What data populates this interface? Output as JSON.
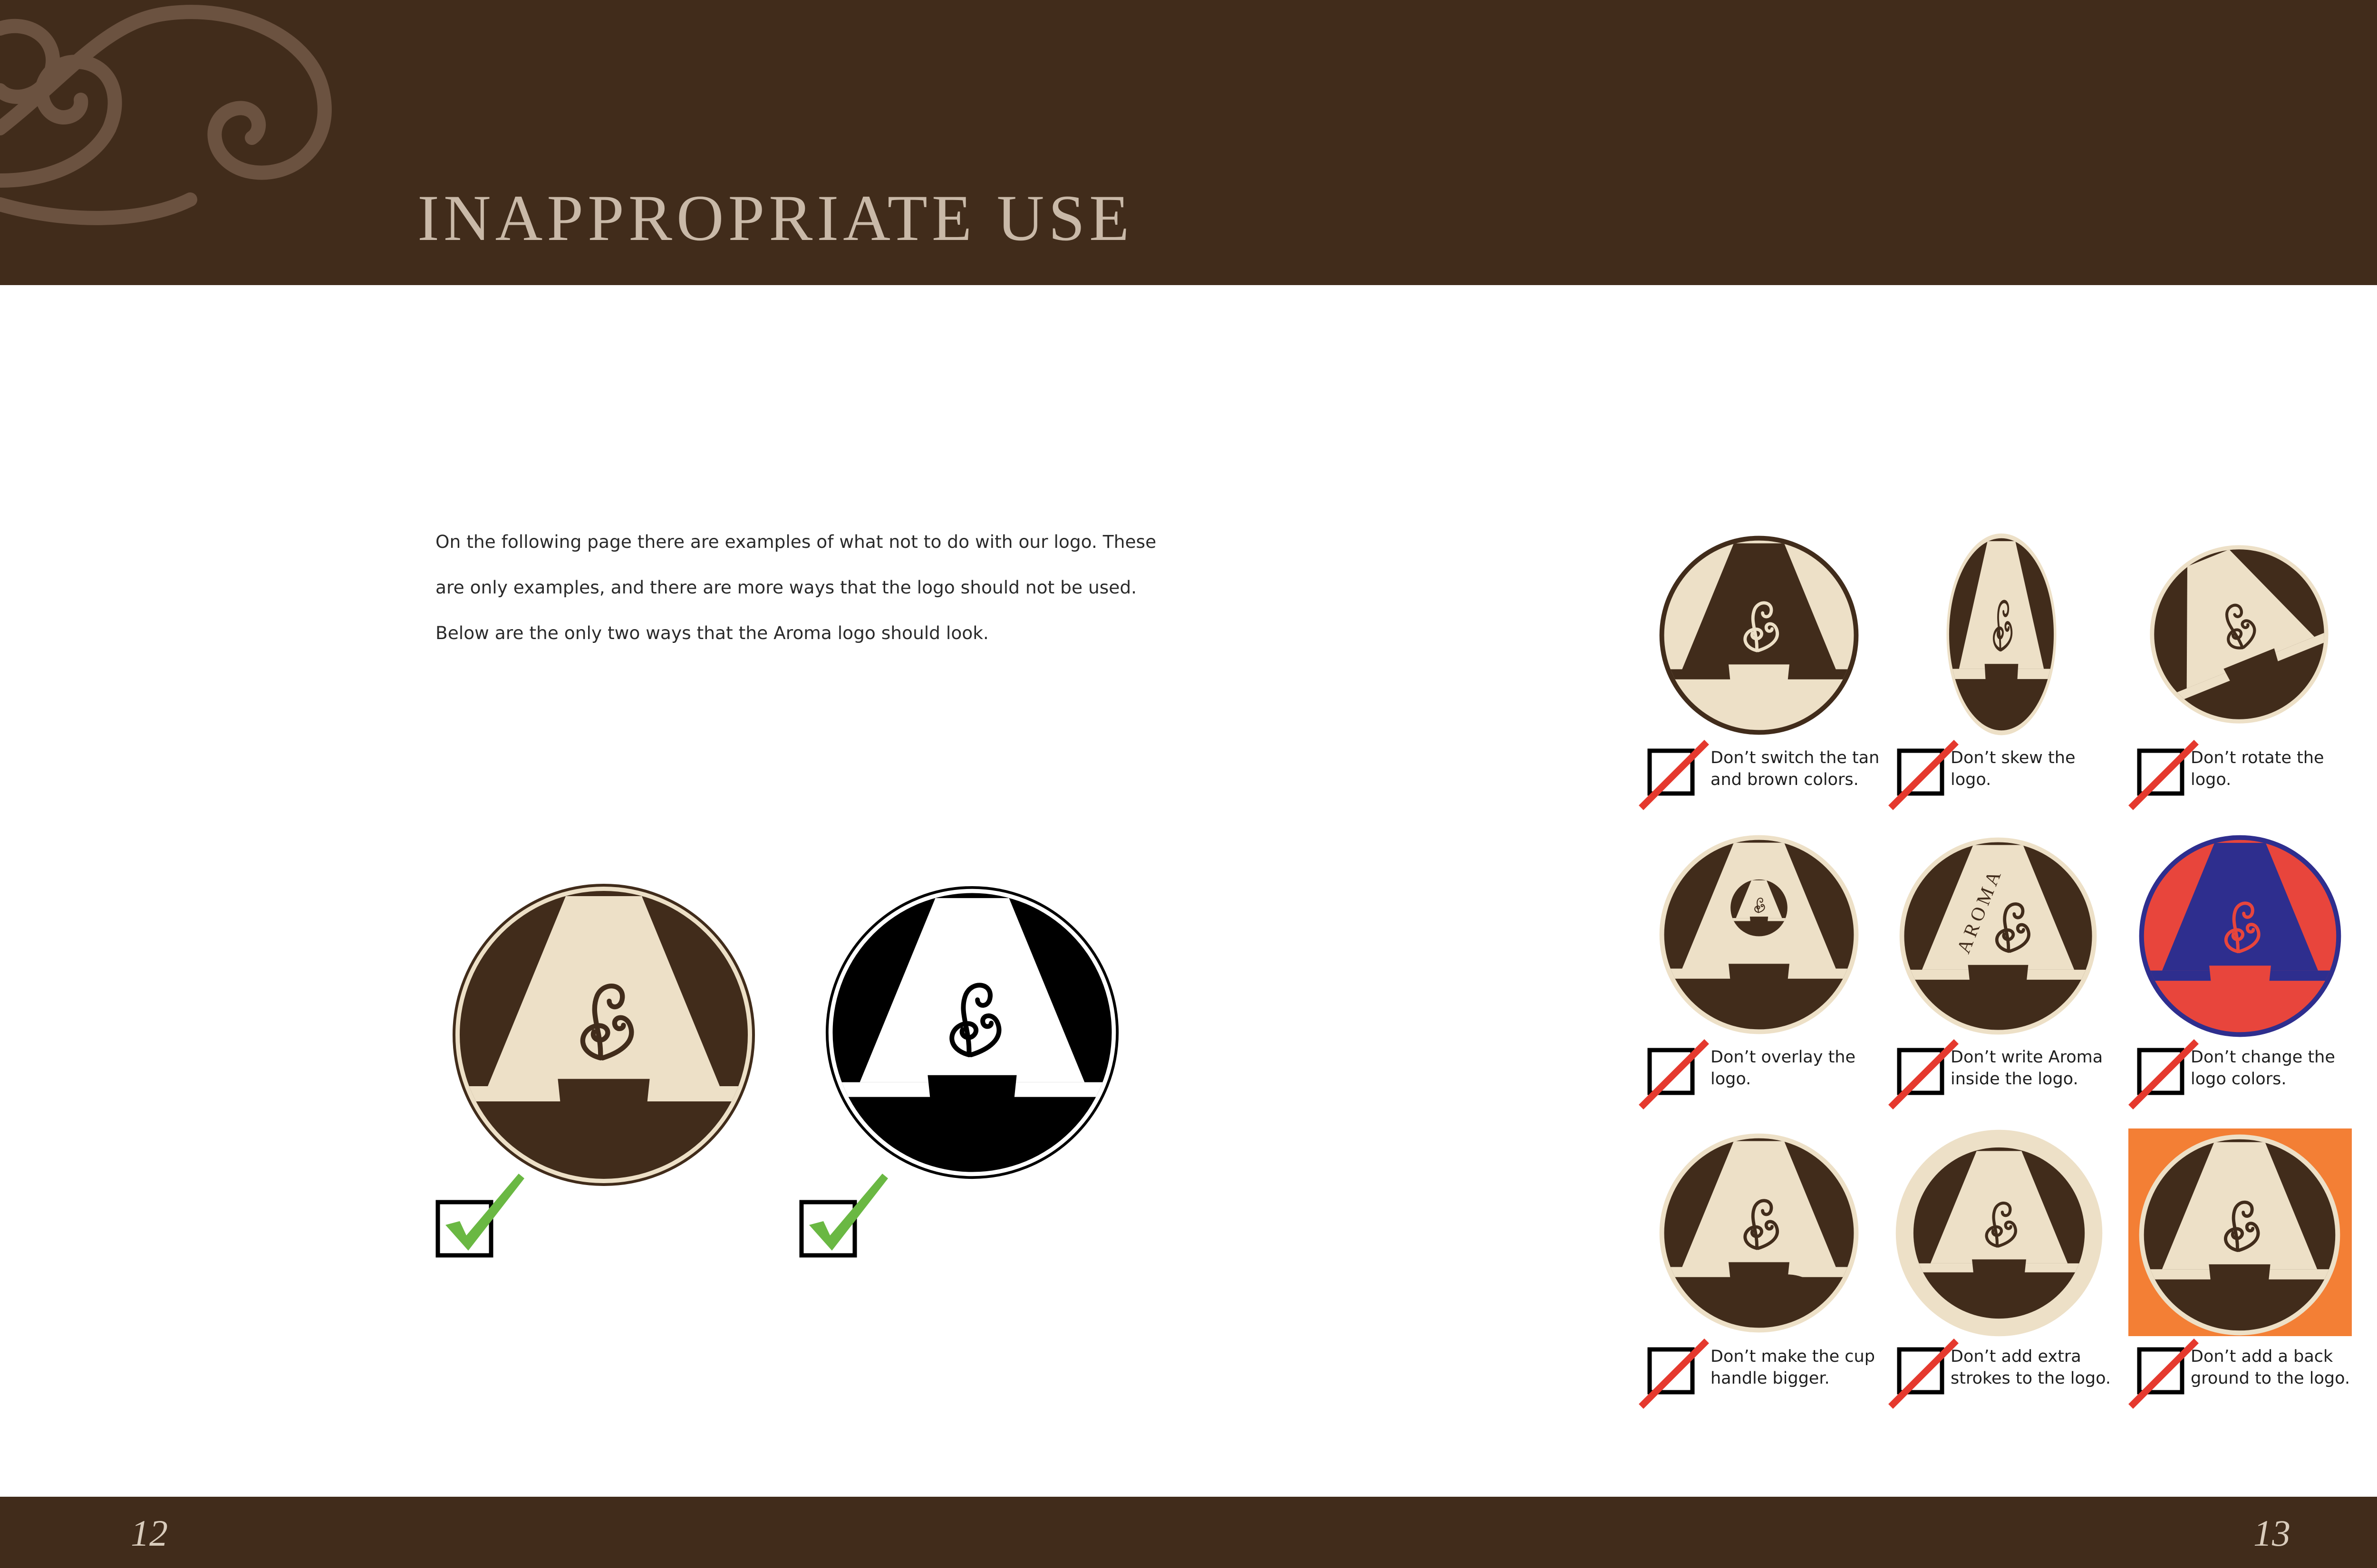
{
  "header": {
    "title": "INAPPROPRIATE USE"
  },
  "intro": {
    "lines": [
      "On the following page there are examples of what not to do with our logo. These",
      "are only examples, and there are more ways that the logo should not be used.",
      "Below are the only two ways that the Aroma logo should look."
    ]
  },
  "examples": [
    {
      "line1": "Don’t switch the tan",
      "line2": "and brown colors."
    },
    {
      "line1": "Don’t skew the",
      "line2": "logo."
    },
    {
      "line1": "Don’t rotate the",
      "line2": "logo."
    },
    {
      "line1": "Don’t overlay the",
      "line2": "logo."
    },
    {
      "line1": "Don’t write Aroma",
      "line2": "inside the logo."
    },
    {
      "line1": "Don’t change the",
      "line2": "logo colors."
    },
    {
      "line1": "Don’t make the cup",
      "line2": "handle bigger."
    },
    {
      "line1": "Don’t add extra",
      "line2": "strokes to the logo."
    },
    {
      "line1": "Don’t add a back",
      "line2": "ground to the logo."
    }
  ],
  "aroma_vertical_text": "AROMA",
  "footer": {
    "page_left": "12",
    "page_right": "13"
  },
  "colors": {
    "brown": "#412c1b",
    "tan": "#ede0c7",
    "check_green": "#6ab843",
    "cross_red": "#e5392e",
    "alt_red": "#e8453c",
    "alt_blue": "#2e2e8e",
    "background_orange": "#f37f35"
  },
  "icons": [
    "swirl-ornament",
    "aroma-logo",
    "check-icon",
    "checkbox-icon",
    "cross-out-icon"
  ]
}
